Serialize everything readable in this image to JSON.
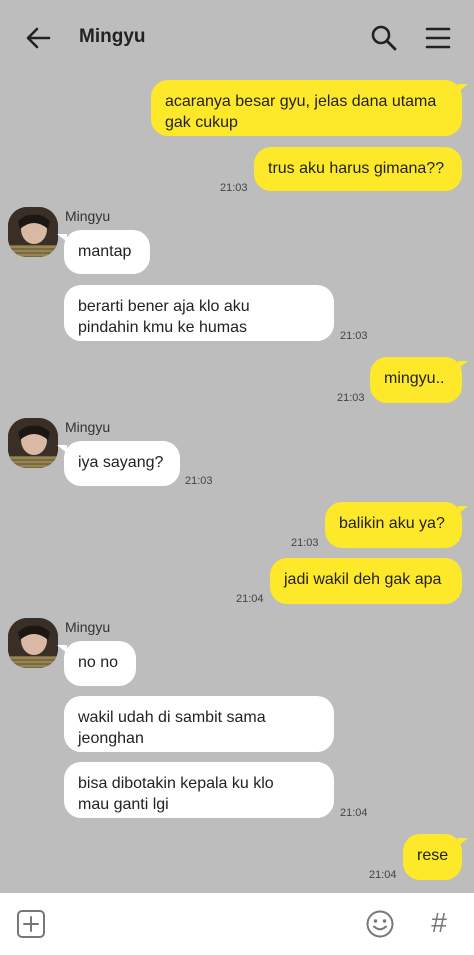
{
  "header": {
    "title": "Mingyu",
    "back_icon": "arrow-left-icon",
    "search_icon": "search-icon",
    "menu_icon": "hamburger-menu-icon"
  },
  "messages": [
    {
      "dir": "out",
      "lines": [
        "acaranya besar gyu, jelas dana utama",
        "gak cukup"
      ]
    },
    {
      "dir": "out",
      "lines": [
        "trus aku harus gimana??"
      ],
      "time": "21:03"
    },
    {
      "dir": "in",
      "sender": "Mingyu",
      "lines": [
        "mantap"
      ]
    },
    {
      "dir": "in",
      "lines": [
        "berarti bener aja klo aku",
        "pindahin kmu ke humas"
      ],
      "time": "21:03"
    },
    {
      "dir": "out",
      "lines": [
        "mingyu.."
      ],
      "time": "21:03"
    },
    {
      "dir": "in",
      "sender": "Mingyu",
      "lines": [
        "iya sayang?"
      ],
      "time": "21:03"
    },
    {
      "dir": "out",
      "lines": [
        "balikin aku ya?"
      ],
      "time": "21:03"
    },
    {
      "dir": "out",
      "lines": [
        "jadi wakil deh gak apa"
      ],
      "time": "21:04"
    },
    {
      "dir": "in",
      "sender": "Mingyu",
      "lines": [
        "no no"
      ]
    },
    {
      "dir": "in",
      "lines": [
        "wakil udah di sambit sama",
        "jeonghan"
      ]
    },
    {
      "dir": "in",
      "lines": [
        "bisa dibotakin kepala ku klo",
        "mau ganti lgi"
      ],
      "time": "21:04"
    },
    {
      "dir": "out",
      "lines": [
        "rese"
      ],
      "time": "21:04"
    }
  ],
  "composer": {
    "plus_icon": "plus-square-icon",
    "emoji_icon": "emoji-smile-icon",
    "hash_label": "#"
  },
  "colors": {
    "background": "#bdbdbd",
    "outgoing_bubble": "#fde82a",
    "incoming_bubble": "#ffffff"
  }
}
